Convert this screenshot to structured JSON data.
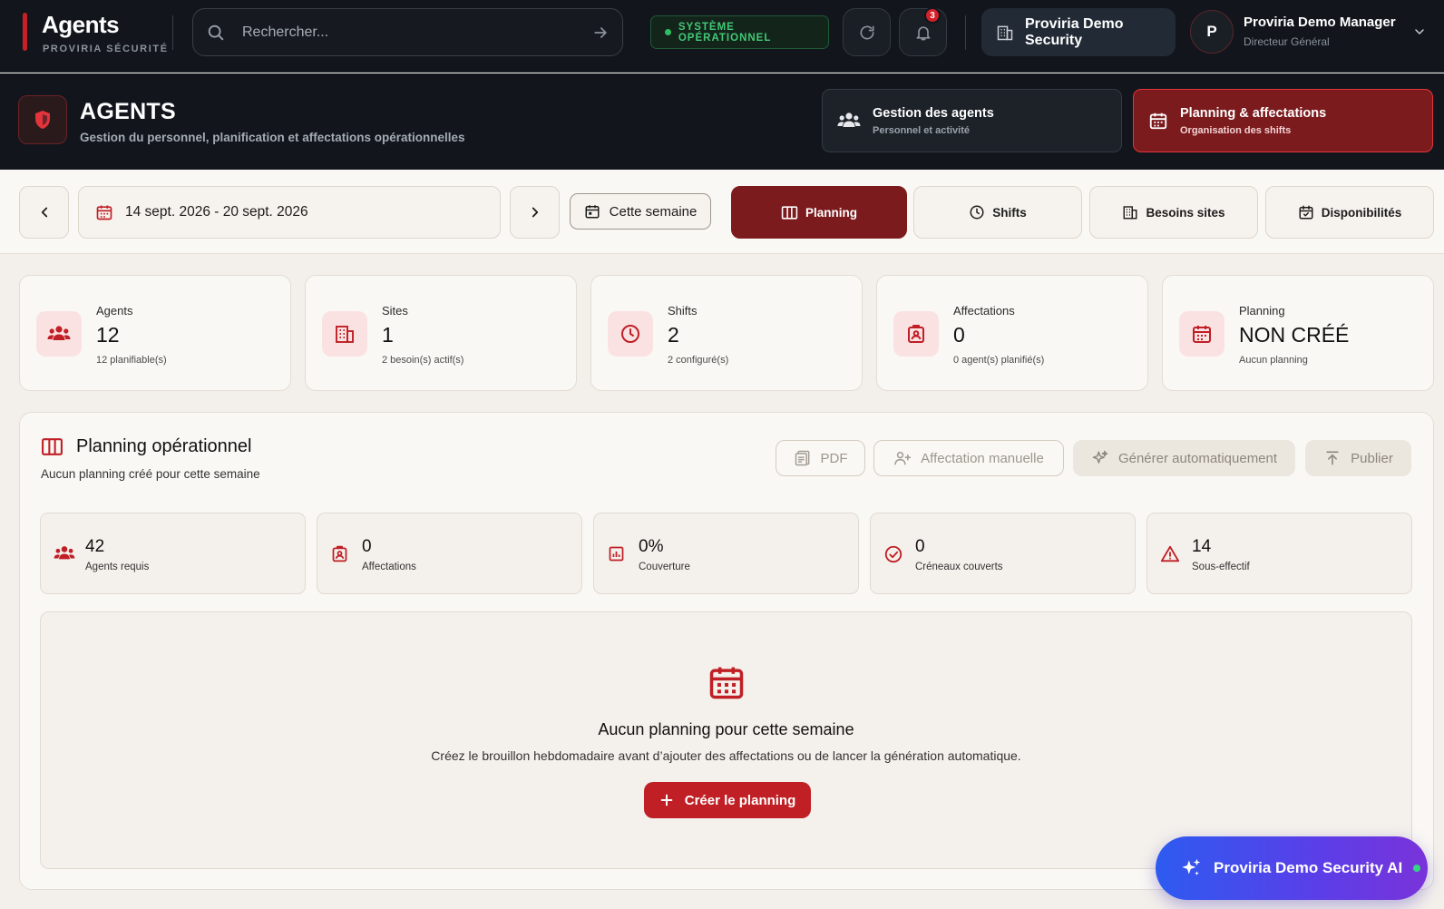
{
  "brand": {
    "title": "Agents",
    "subtitle": "PROVIRIA SÉCURITÉ"
  },
  "search": {
    "placeholder": "Rechercher..."
  },
  "system_status": {
    "label": "SYSTÈME OPÉRATIONNEL",
    "color": "#43c877"
  },
  "notifications": {
    "count": "3"
  },
  "organization": {
    "label": "Proviria Demo Security"
  },
  "user": {
    "initial": "P",
    "name": "Proviria Demo Manager",
    "role": "Directeur Général"
  },
  "module": {
    "title": "AGENTS",
    "subtitle": "Gestion du personnel, planification et affectations opérationnelles",
    "tabs": [
      {
        "title": "Gestion des agents",
        "subtitle": "Personnel et activité",
        "icon": "users-icon"
      },
      {
        "title": "Planning & affectations",
        "subtitle": "Organisation des shifts",
        "icon": "calendar-icon",
        "active": true
      }
    ]
  },
  "toolbar": {
    "date_range": "14 sept. 2026 - 20 sept. 2026",
    "this_week": "Cette semaine",
    "views": [
      {
        "label": "Planning",
        "icon": "columns-icon",
        "active": true
      },
      {
        "label": "Shifts",
        "icon": "clock-icon"
      },
      {
        "label": "Besoins sites",
        "icon": "building-icon"
      },
      {
        "label": "Disponibilités",
        "icon": "calendar-check-icon"
      }
    ]
  },
  "stats": [
    {
      "label": "Agents",
      "value": "12",
      "sub": "12 planifiable(s)",
      "icon": "users-icon"
    },
    {
      "label": "Sites",
      "value": "1",
      "sub": "2 besoin(s) actif(s)",
      "icon": "building-icon"
    },
    {
      "label": "Shifts",
      "value": "2",
      "sub": "2 configuré(s)",
      "icon": "clock-icon"
    },
    {
      "label": "Affectations",
      "value": "0",
      "sub": "0 agent(s) planifié(s)",
      "icon": "badge-icon"
    },
    {
      "label": "Planning",
      "value": "NON CRÉÉ",
      "sub": "Aucun planning",
      "icon": "calendar-icon"
    }
  ],
  "planning": {
    "title": "Planning opérationnel",
    "subtitle": "Aucun planning créé pour cette semaine",
    "actions": [
      {
        "label": "PDF",
        "icon": "pdf-icon"
      },
      {
        "label": "Affectation manuelle",
        "icon": "user-plus-icon"
      },
      {
        "label": "Générer automatiquement",
        "icon": "sparkles-icon"
      },
      {
        "label": "Publier",
        "icon": "upload-icon"
      }
    ],
    "metrics": [
      {
        "value": "42",
        "label": "Agents requis",
        "icon": "users-icon"
      },
      {
        "value": "0",
        "label": "Affectations",
        "icon": "badge-icon"
      },
      {
        "value": "0%",
        "label": "Couverture",
        "icon": "chart-icon"
      },
      {
        "value": "0",
        "label": "Créneaux couverts",
        "icon": "check-circle-icon"
      },
      {
        "value": "14",
        "label": "Sous-effectif",
        "icon": "warning-icon"
      }
    ],
    "empty_state": {
      "title": "Aucun planning pour cette semaine",
      "description": "Créez le brouillon hebdomadaire avant d’ajouter des affectations ou de lancer la génération automatique.",
      "button": "Créer le planning"
    }
  },
  "assistant": {
    "label": "Proviria Demo Security AI"
  },
  "colors": {
    "accent": "#c01f25",
    "accent_dark": "#7c1b1e",
    "topbar": "#12161c"
  }
}
